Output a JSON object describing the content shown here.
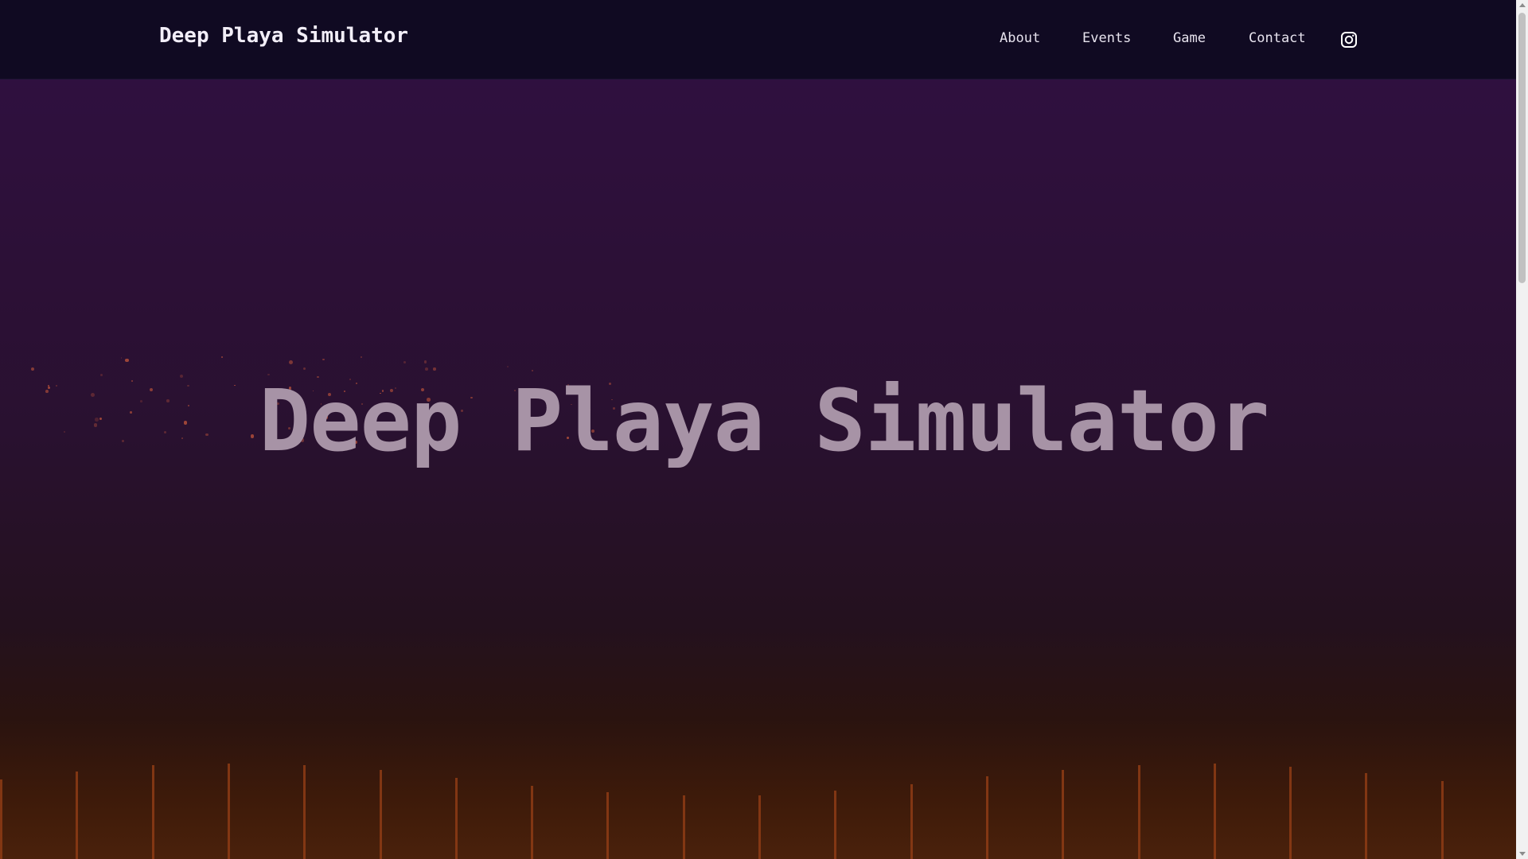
{
  "header": {
    "brand": "Deep Playa Simulator",
    "nav": [
      {
        "label": "About"
      },
      {
        "label": "Events"
      },
      {
        "label": "Game"
      },
      {
        "label": "Contact"
      }
    ],
    "social_icon": "instagram-icon"
  },
  "hero": {
    "title": "Deep Playa Simulator"
  },
  "colors": {
    "header_bg": "#100a22",
    "hero_top": "#2f103f",
    "hero_bottom": "#4a210b",
    "title_text": "#a793a6",
    "particle": "#b5503a",
    "bar": "#8a3a14"
  }
}
